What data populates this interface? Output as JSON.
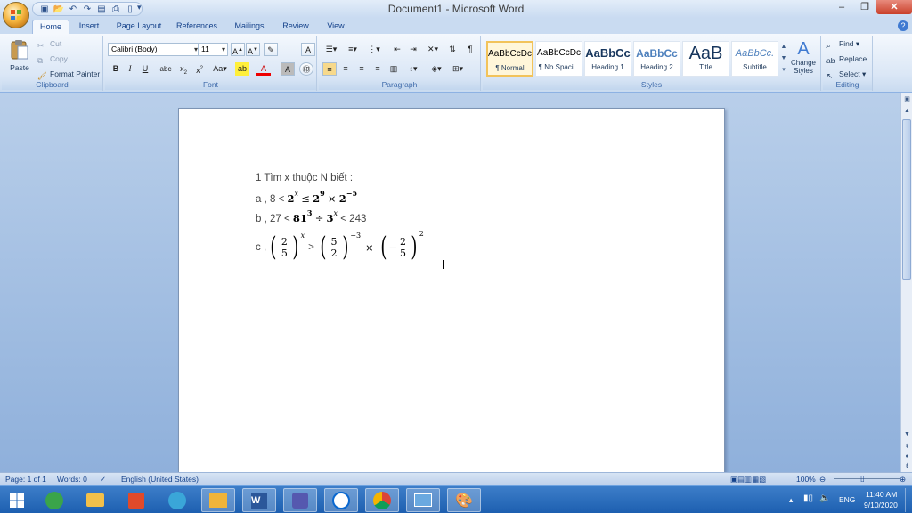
{
  "window": {
    "title": "Document1 - Microsoft Word"
  },
  "tabs": [
    "Home",
    "Insert",
    "Page Layout",
    "References",
    "Mailings",
    "Review",
    "View"
  ],
  "ribbon": {
    "clipboard": {
      "label": "Clipboard",
      "paste": "Paste",
      "cut": "Cut",
      "copy": "Copy",
      "format_painter": "Format Painter"
    },
    "font": {
      "label": "Font",
      "font_name": "Calibri (Body)",
      "font_size": "11"
    },
    "paragraph": {
      "label": "Paragraph"
    },
    "styles": {
      "label": "Styles",
      "items": [
        {
          "sample": "AaBbCcDc",
          "name": "¶ Normal"
        },
        {
          "sample": "AaBbCcDc",
          "name": "¶ No Spaci..."
        },
        {
          "sample": "AaBbCc",
          "name": "Heading 1"
        },
        {
          "sample": "AaBbCc",
          "name": "Heading 2"
        },
        {
          "sample": "AaB",
          "name": "Title"
        },
        {
          "sample": "AaBbCc.",
          "name": "Subtitle"
        }
      ],
      "change_styles": "Change Styles"
    },
    "editing": {
      "label": "Editing",
      "find": "Find",
      "replace": "Replace",
      "select": "Select"
    }
  },
  "document": {
    "line1": "1 Tìm x thuộc N biết :",
    "line2": {
      "prefix": "a , 8 <",
      "b1": "2",
      "e1": "x",
      "le": "≤",
      "b2": "2",
      "e2": "9",
      "times": "×",
      "b3": "2",
      "e3": "−5"
    },
    "line3": {
      "prefix": "b , 27 <",
      "b1": "81",
      "e1": "3",
      "div": "÷",
      "b2": "3",
      "e2": "x",
      "suffix": "< 243"
    },
    "line4": {
      "prefix": "c ,",
      "f1n": "2",
      "f1d": "5",
      "e1": "x",
      "gt": ">",
      "f2n": "5",
      "f2d": "2",
      "e2": "−3",
      "times": "×",
      "minus": "−",
      "f3n": "2",
      "f3d": "5",
      "e3": "2"
    }
  },
  "status": {
    "page": "Page: 1 of 1",
    "words": "Words: 0",
    "language": "English (United States)",
    "zoom": "100%"
  },
  "taskbar": {
    "tray_lang": "ENG",
    "time": "11:40 AM",
    "date": "9/10/2020"
  }
}
